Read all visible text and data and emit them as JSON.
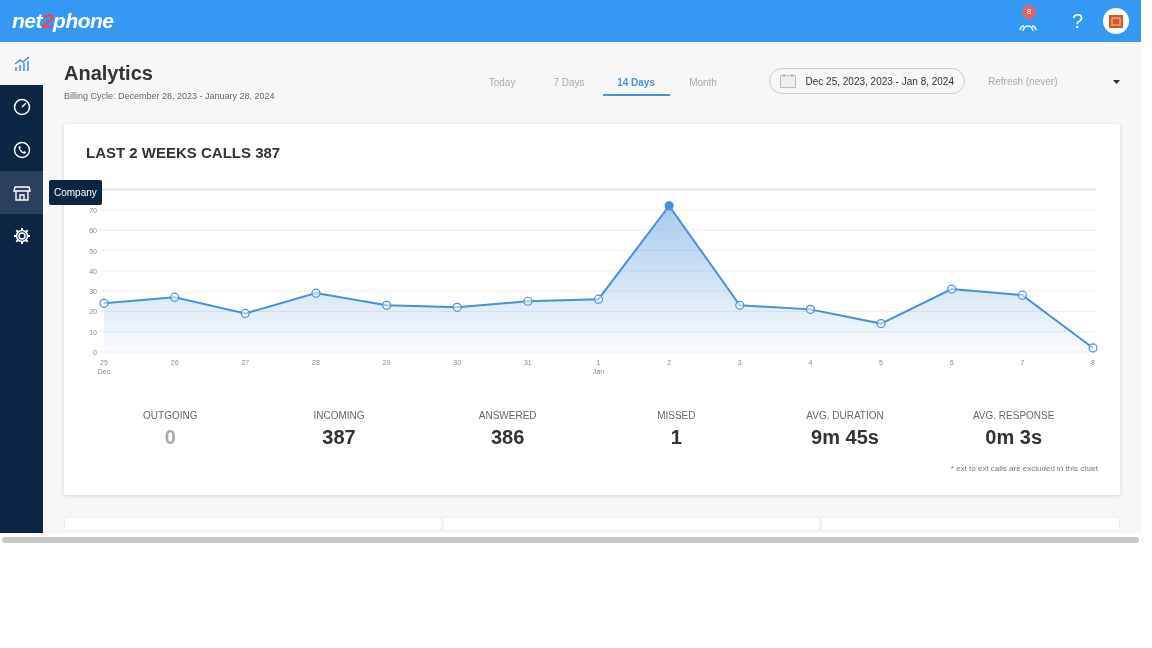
{
  "header": {
    "logo_parts": [
      "net",
      "2",
      "phone"
    ],
    "notification_count": "8",
    "help": "?"
  },
  "sidebar": {
    "items": [
      {
        "selected": true,
        "hovered": false
      },
      {
        "selected": false,
        "hovered": false
      },
      {
        "selected": false,
        "hovered": false
      },
      {
        "selected": false,
        "hovered": true
      },
      {
        "selected": false,
        "hovered": false
      }
    ],
    "tooltip": "Company"
  },
  "page": {
    "title": "Analytics",
    "subtitle": "Billing Cycle: December 28, 2023 - January 28, 2024"
  },
  "tabs": [
    {
      "label": "Today",
      "selected": false
    },
    {
      "label": "7 Days",
      "selected": false
    },
    {
      "label": "14 Days",
      "selected": true
    },
    {
      "label": "Month",
      "selected": false
    }
  ],
  "date_range": {
    "value": "Dec 25, 2023, 2023 - Jan 8, 2024"
  },
  "refresh": {
    "value": "Refresh (never)"
  },
  "card": {
    "title": "LAST 2 WEEKS CALLS 387",
    "chart_data": {
      "type": "area",
      "categories": [
        "25",
        "26",
        "27",
        "28",
        "29",
        "30",
        "31",
        "1",
        "2",
        "3",
        "4",
        "5",
        "6",
        "7",
        "8"
      ],
      "annotations": [
        "Dec",
        "Jan"
      ],
      "series": [
        {
          "color": "#4a90d9",
          "values": [
            24,
            27,
            19,
            29,
            23,
            22,
            25,
            26,
            72,
            23,
            21,
            14,
            31,
            28,
            2
          ]
        }
      ],
      "ylim": [
        0,
        80
      ],
      "yticks": [
        0,
        10,
        20,
        30,
        40,
        50,
        60,
        70
      ],
      "grid": true
    },
    "stats": [
      {
        "label": "OUTGOING",
        "value": "0",
        "dimmed": true
      },
      {
        "label": "INCOMING",
        "value": "387",
        "dimmed": false
      },
      {
        "label": "ANSWERED",
        "value": "386",
        "dimmed": false
      },
      {
        "label": "MISSED",
        "value": "1",
        "dimmed": false
      },
      {
        "label": "AVG. DURATION",
        "value": "9m 45s",
        "dimmed": false
      },
      {
        "label": "AVG. RESPONSE",
        "value": "0m 3s",
        "dimmed": false
      }
    ],
    "footnote": "* ext to ext calls are excluded in this chart"
  }
}
